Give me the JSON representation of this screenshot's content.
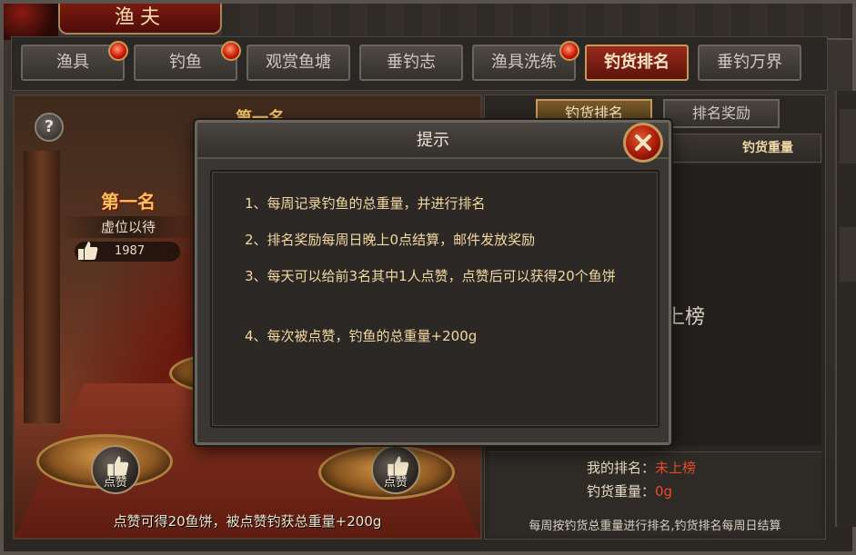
{
  "window": {
    "title": "渔夫"
  },
  "tabs": [
    {
      "label": "渔具",
      "dot": true
    },
    {
      "label": "钓鱼",
      "dot": true
    },
    {
      "label": "观赏鱼塘",
      "dot": false
    },
    {
      "label": "垂钓志",
      "dot": false
    },
    {
      "label": "渔具洗练",
      "dot": true
    },
    {
      "label": "钓货排名",
      "dot": false,
      "active": true
    },
    {
      "label": "垂钓万界",
      "dot": false
    }
  ],
  "scene": {
    "help_label": "?",
    "rank_title": "第一名",
    "rank_title_2": "第一名",
    "first_name": "虚位以待",
    "first_likes": "1987",
    "like_button_left": "点赞",
    "like_button_right": "点赞",
    "footer": "点赞可得20鱼饼，被点赞钓获总重量+200g"
  },
  "ranking_panel": {
    "tabs": [
      {
        "label": "钓货排名",
        "active": true
      },
      {
        "label": "排名奖励",
        "active": false
      }
    ],
    "header_weight": "钓货重量",
    "empty_message": "暂无人上榜",
    "my_rank_label": "我的排名：",
    "my_rank_value": "未上榜",
    "my_weight_label": "钓货重量：",
    "my_weight_value": "0g",
    "note": "每周按钓货总重量进行排名,钓货排名每周日结算"
  },
  "modal": {
    "title": "提示",
    "tips": [
      "1、每周记录钓鱼的总重量，并进行排名",
      "2、排名奖励每周日晚上0点结算，邮件发放奖励",
      "3、每天可以给前3名其中1人点赞，点赞后可以获得20个鱼饼",
      "4、每次被点赞，钓鱼的总重量+200g"
    ]
  },
  "colors": {
    "accent_red": "#e84a2a",
    "tip_text": "#f4d8a0",
    "gold": "#f4c460"
  }
}
